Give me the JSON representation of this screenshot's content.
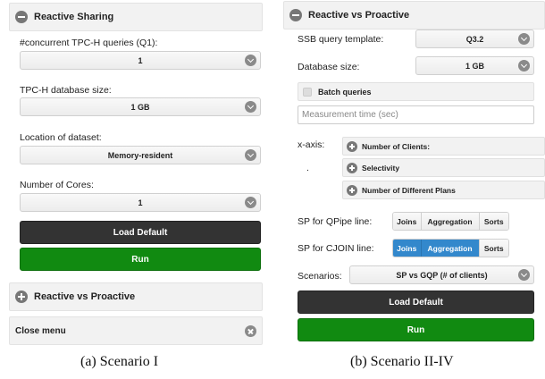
{
  "left": {
    "header": "Reactive Sharing",
    "q1_label": "#concurrent TPC-H queries (Q1):",
    "q1_value": "1",
    "db_size_label": "TPC-H database size:",
    "db_size_value": "1 GB",
    "location_label": "Location of dataset:",
    "location_value": "Memory-resident",
    "cores_label": "Number of Cores:",
    "cores_value": "1",
    "load_default": "Load Default",
    "run": "Run",
    "reactive_vs_proactive": "Reactive vs Proactive",
    "close_menu": "Close menu",
    "caption": "(a) Scenario I"
  },
  "right": {
    "header": "Reactive vs Proactive",
    "ssb_label": "SSB query template:",
    "ssb_value": "Q3.2",
    "db_size_label": "Database size:",
    "db_size_value": "1 GB",
    "batch_queries": "Batch queries",
    "measurement_placeholder": "Measurement time (sec)",
    "xaxis_label": "x-axis:",
    "xaxis_dot": ".",
    "xaxis_options": [
      "Number of Clients:",
      "Selectivity",
      "Number of Different Plans"
    ],
    "sp_qpipe_label": "SP for QPipe line:",
    "sp_cjoin_label": "SP for CJOIN line:",
    "seg_joins": "Joins",
    "seg_aggregation": "Aggregation",
    "seg_sorts": "Sorts",
    "scenarios_label": "Scenarios:",
    "scenarios_value": "SP vs GQP (# of clients)",
    "load_default": "Load Default",
    "run": "Run",
    "caption": "(b) Scenario II-IV"
  },
  "colors": {
    "dark_button": "#333333",
    "run_button": "#118a11",
    "selected_segment": "#3388cc"
  }
}
